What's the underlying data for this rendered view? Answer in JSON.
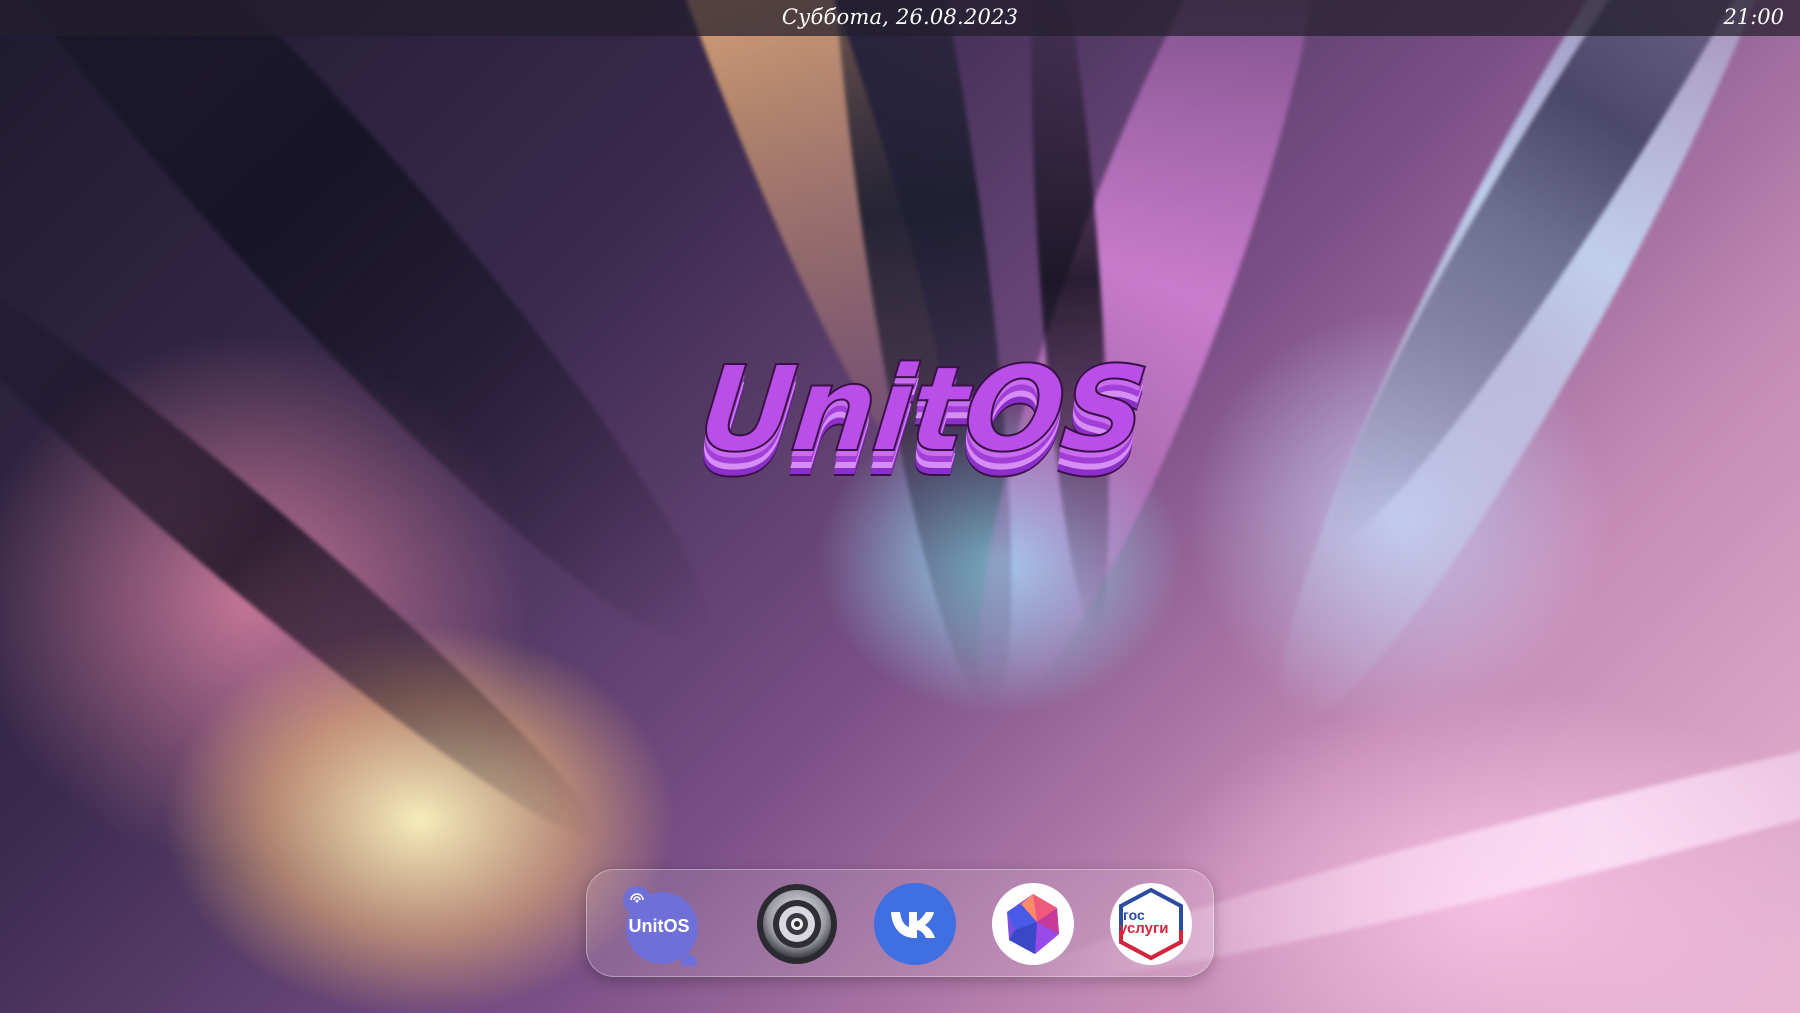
{
  "top_bar": {
    "date": "Суббота, 26.08.2023",
    "time": "21:00"
  },
  "desktop": {
    "logo_text": "UnitOS"
  },
  "dock": {
    "items": [
      {
        "name": "UnitOS",
        "label": "UnitOS",
        "icon": "unitos-chat-icon",
        "color": "#6f6fd8"
      },
      {
        "name": "Settings",
        "icon": "settings-dial-icon",
        "color": "#4a4a52"
      },
      {
        "name": "VK",
        "icon": "vk-icon",
        "color": "#3f6fe0"
      },
      {
        "name": "Crystal",
        "icon": "crystal-icon",
        "color": "#8a4fe0"
      },
      {
        "name": "Gosuslugi",
        "label_line1": "гос",
        "label_line2": "услуги",
        "icon": "gosuslugi-icon",
        "color": "#d8243a"
      }
    ]
  }
}
